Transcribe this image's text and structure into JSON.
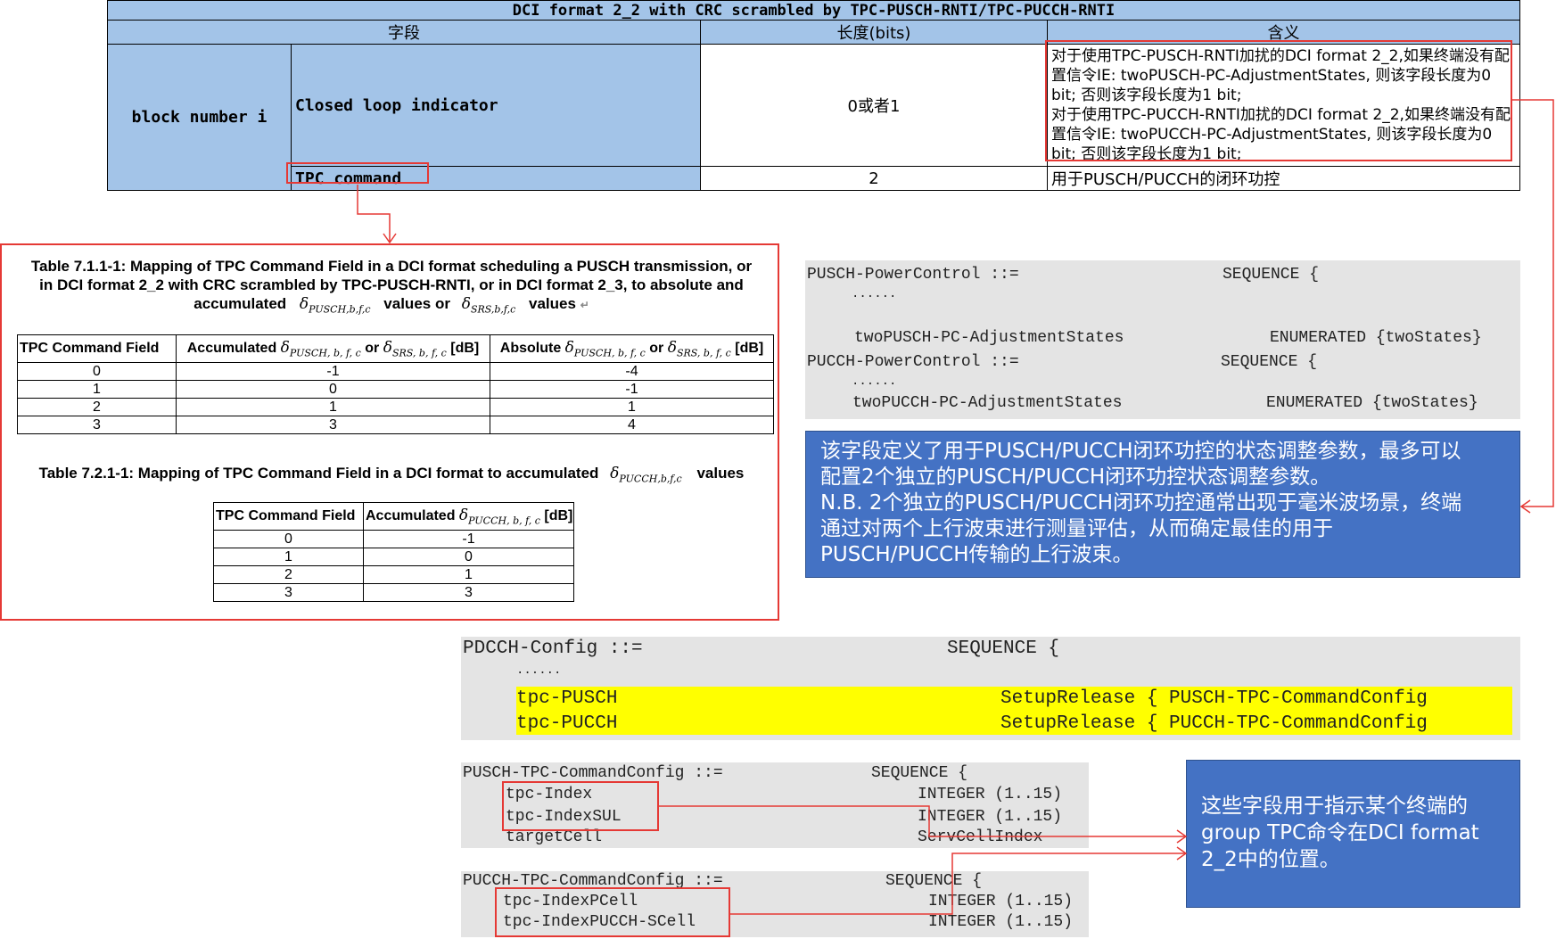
{
  "dci_table": {
    "title": "DCI format 2_2 with CRC scrambled by TPC-PUSCH-RNTI/TPC-PUCCH-RNTI",
    "headers": [
      "字段",
      "长度(bits)",
      "含义"
    ],
    "block_label": "block number i",
    "rows": [
      {
        "field": "Closed loop indicator",
        "length": "0或者1",
        "meaning": [
          "对于使用TPC-PUSCH-RNTI加扰的DCI format 2_2,如果终端没有配置信令IE: twoPUSCH-PC-AdjustmentStates, 则该字段长度为0 bit; 否则该字段长度为1 bit;",
          "对于使用TPC-PUCCH-RNTI加扰的DCI format 2_2,如果终端没有配置信令IE: twoPUCCH-PC-AdjustmentStates, 则该字段长度为0 bit; 否则该字段长度为1 bit;"
        ]
      },
      {
        "field": "TPC command",
        "length": "2",
        "meaning": [
          "用于PUSCH/PUCCH的闭环功控"
        ]
      }
    ]
  },
  "table_7_1_1_1": {
    "caption": {
      "line1": "Table 7.1.1-1: Mapping of TPC Command Field in a DCI format scheduling a PUSCH transmission, or",
      "line2": "in DCI format 2_2 with CRC scrambled by TPC-PUSCH-RNTI, or in DCI format 2_3, to absolute and",
      "pre": "accumulated",
      "mid": "values or",
      "post": "values"
    },
    "headers": {
      "c1": "TPC Command Field",
      "c2a": "Accumulated",
      "c2b": "or",
      "c2c": "[dB]",
      "c3a": "Absolute",
      "c3b": "or",
      "c3c": "[dB]"
    },
    "rows": [
      [
        "0",
        "-1",
        "-4"
      ],
      [
        "1",
        "0",
        "-1"
      ],
      [
        "2",
        "1",
        "1"
      ],
      [
        "3",
        "3",
        "4"
      ]
    ]
  },
  "table_7_2_1_1": {
    "caption": {
      "pre": "Table 7.2.1-1: Mapping of TPC Command Field in a DCI format to accumulated",
      "post": "values"
    },
    "headers": {
      "c1": "TPC Command Field",
      "c2a": "Accumulated",
      "c2c": "[dB]"
    },
    "rows": [
      [
        "0",
        "-1"
      ],
      [
        "1",
        "0"
      ],
      [
        "2",
        "1"
      ],
      [
        "3",
        "3"
      ]
    ]
  },
  "symbols": {
    "delta": "δ",
    "pusch": "PUSCH, b, f, c",
    "srs": "SRS, b, f, c",
    "pucch": "PUCCH, b, f, c",
    "pusch_cap": "PUSCH,b,f,c",
    "srs_cap": "SRS,b,f,c",
    "pucch_cap": "PUCCH,b,f,c"
  },
  "power_control_code": {
    "l1a": "PUSCH-PowerControl ::=",
    "l1b": "SEQUENCE {",
    "dots": "......",
    "l3a": "twoPUSCH-PC-AdjustmentStates",
    "l3b": "ENUMERATED {twoStates}",
    "l4a": "PUCCH-PowerControl ::=",
    "l4b": "SEQUENCE {",
    "l6a": "twoPUCCH-PC-AdjustmentStates",
    "l6b": "ENUMERATED {twoStates}"
  },
  "note1": {
    "lines": [
      "该字段定义了用于PUSCH/PUCCH闭环功控的状态调整参数，最多可以",
      "配置2个独立的PUSCH/PUCCH闭环功控状态调整参数。",
      "N.B. 2个独立的PUSCH/PUCCH闭环功控通常出现于毫米波场景，终端",
      "通过对两个上行波束进行测量评估，从而确定最佳的用于",
      "PUSCH/PUCCH传输的上行波束。"
    ]
  },
  "pdcch_code": {
    "l1a": "PDCCH-Config ::=",
    "l1b": "SEQUENCE {",
    "dots": "......",
    "l3a": "tpc-PUSCH",
    "l3b": "SetupRelease { PUSCH-TPC-CommandConfig",
    "l4a": "tpc-PUCCH",
    "l4b": "SetupRelease { PUCCH-TPC-CommandConfig"
  },
  "pusch_tpc_code": {
    "l1a": "PUSCH-TPC-CommandConfig ::=",
    "l1b": "SEQUENCE {",
    "l2a": "tpc-Index",
    "l2b": "INTEGER (1..15)",
    "l3a": "tpc-IndexSUL",
    "l3b": "INTEGER (1..15)",
    "l4a": "targetCell",
    "l4b": "ServCellIndex"
  },
  "pucch_tpc_code": {
    "l1a": "PUCCH-TPC-CommandConfig ::=",
    "l1b": "SEQUENCE {",
    "l2a": "tpc-IndexPCell",
    "l2b": "INTEGER (1..15)",
    "l3a": "tpc-IndexPUCCH-SCell",
    "l3b": "INTEGER (1..15)"
  },
  "note2": {
    "lines": [
      "这些字段用于指示某个终端的",
      "group TPC命令在DCI format",
      "2_2中的位置。"
    ]
  },
  "colors": {
    "header_blue": "#a3c4e8",
    "highlight": "#ffff00",
    "red": "#e53935",
    "note_blue": "#4472c4",
    "code_gray": "#e4e4e4"
  },
  "return_mark": "↵"
}
